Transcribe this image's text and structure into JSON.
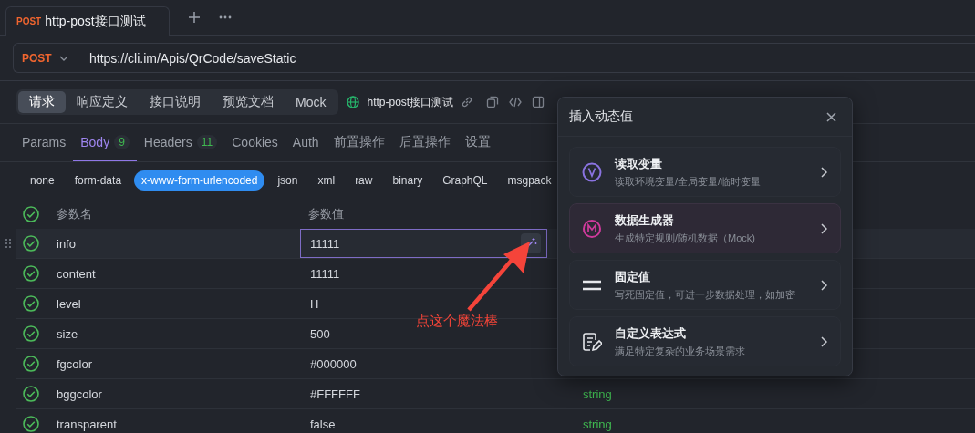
{
  "tab": {
    "method": "POST",
    "title": "http-post接口测试",
    "selected": true
  },
  "request": {
    "method": "POST",
    "url": "https://cli.im/Apis/QrCode/saveStatic"
  },
  "sub_tabs": [
    {
      "label": "请求",
      "selected": true
    },
    {
      "label": "响应定义",
      "selected": false
    },
    {
      "label": "接口说明",
      "selected": false
    },
    {
      "label": "预览文档",
      "selected": false
    },
    {
      "label": "Mock",
      "selected": false
    }
  ],
  "environment": "http-post接口测试",
  "param_tabs": [
    {
      "label": "Params",
      "selected": false
    },
    {
      "label": "Body",
      "count": "9",
      "selected": true
    },
    {
      "label": "Headers",
      "count": "11",
      "selected": false
    },
    {
      "label": "Cookies",
      "selected": false
    },
    {
      "label": "Auth",
      "selected": false
    },
    {
      "label": "前置操作",
      "selected": false
    },
    {
      "label": "后置操作",
      "selected": false
    },
    {
      "label": "设置",
      "selected": false
    }
  ],
  "body_types": [
    {
      "label": "none",
      "selected": false
    },
    {
      "label": "form-data",
      "selected": false
    },
    {
      "label": "x-www-form-urlencoded",
      "selected": true
    },
    {
      "label": "json",
      "selected": false
    },
    {
      "label": "xml",
      "selected": false
    },
    {
      "label": "raw",
      "selected": false
    },
    {
      "label": "binary",
      "selected": false
    },
    {
      "label": "GraphQL",
      "selected": false
    },
    {
      "label": "msgpack",
      "selected": false
    }
  ],
  "table": {
    "columns": [
      "参数名",
      "参数值"
    ],
    "all_checked": true,
    "rows": [
      {
        "name": "info",
        "value": "11111",
        "checked": true,
        "editing": true
      },
      {
        "name": "content",
        "value": "11111",
        "checked": true,
        "editing": false
      },
      {
        "name": "level",
        "value": "H",
        "checked": true,
        "editing": false
      },
      {
        "name": "size",
        "value": "500",
        "checked": true,
        "editing": false
      },
      {
        "name": "fgcolor",
        "value": "#000000",
        "checked": true,
        "editing": false
      },
      {
        "name": "bggcolor",
        "value": "#FFFFFF",
        "type": "string",
        "checked": true,
        "editing": false
      },
      {
        "name": "transparent",
        "value": "false",
        "type": "string",
        "checked": true,
        "editing": false
      }
    ]
  },
  "popup": {
    "title": "插入动态值",
    "items": [
      {
        "kind": "variable",
        "title": "读取变量",
        "description": "读取环境变量/全局变量/临时变量",
        "selected": false
      },
      {
        "kind": "mock",
        "title": "数据生成器",
        "description": "生成特定规则/随机数据（Mock)",
        "selected": true
      },
      {
        "kind": "fixed",
        "title": "固定值",
        "description": "写死固定值，可进一步数据处理，如加密",
        "selected": false
      },
      {
        "kind": "expression",
        "title": "自定义表达式",
        "description": "满足特定复杂的业务场景需求",
        "selected": false
      }
    ]
  },
  "annotation": "点这个魔法棒"
}
